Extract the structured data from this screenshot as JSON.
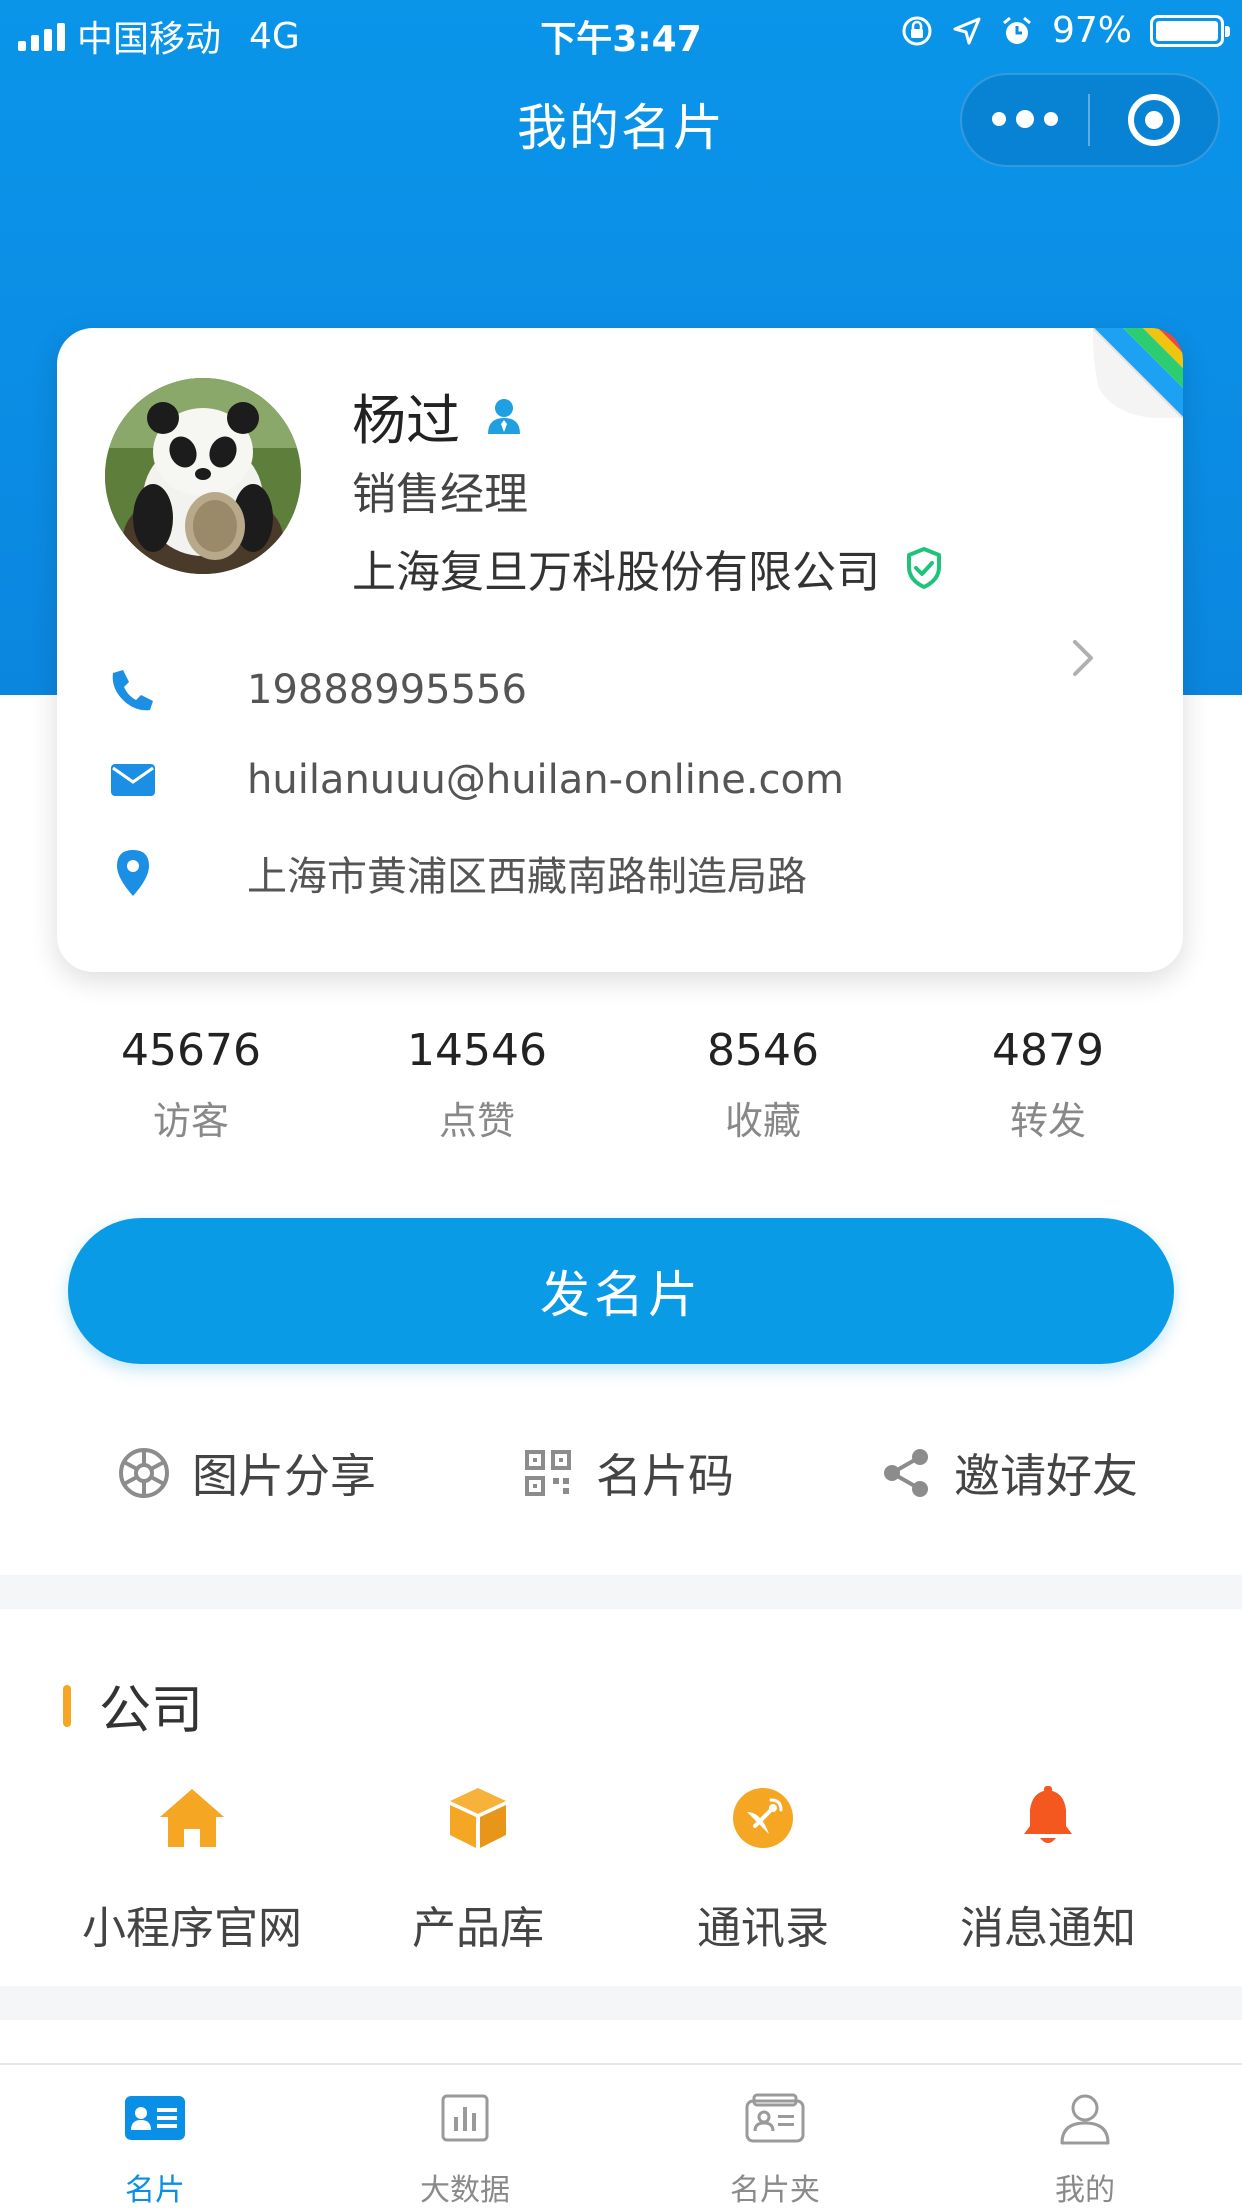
{
  "status_bar": {
    "carrier": "中国移动",
    "network": "4G",
    "time": "下午3:47",
    "battery": "97%"
  },
  "nav": {
    "title": "我的名片"
  },
  "card": {
    "name": "杨过",
    "job_title": "销售经理",
    "company": "上海复旦万科股份有限公司",
    "phone": "19888995556",
    "email": "huilanuuu@huilan-online.com",
    "address": "上海市黄浦区西藏南路制造局路"
  },
  "stats": [
    {
      "value": "45676",
      "label": "访客"
    },
    {
      "value": "14546",
      "label": "点赞"
    },
    {
      "value": "8546",
      "label": "收藏"
    },
    {
      "value": "4879",
      "label": "转发"
    }
  ],
  "send_button": "发名片",
  "actions": {
    "share_image": "图片分享",
    "card_code": "名片码",
    "invite": "邀请好友"
  },
  "company_section": {
    "title": "公司",
    "items": [
      {
        "label": "小程序官网",
        "icon": "home-icon",
        "color": "#f5a623"
      },
      {
        "label": "产品库",
        "icon": "box-icon",
        "color": "#f5a623"
      },
      {
        "label": "通讯录",
        "icon": "satellite-icon",
        "color": "#f5a623"
      },
      {
        "label": "消息通知",
        "icon": "bell-icon",
        "color": "#f5581e"
      }
    ]
  },
  "tabbar": {
    "items": [
      {
        "label": "名片",
        "icon": "card-icon",
        "active": true
      },
      {
        "label": "大数据",
        "icon": "chart-icon",
        "active": false
      },
      {
        "label": "名片夹",
        "icon": "cardholder-icon",
        "active": false
      },
      {
        "label": "我的",
        "icon": "user-icon",
        "active": false
      }
    ]
  },
  "colors": {
    "primary": "#0a9be6",
    "accent_orange": "#f5a623",
    "verified_green": "#1fc47a"
  }
}
